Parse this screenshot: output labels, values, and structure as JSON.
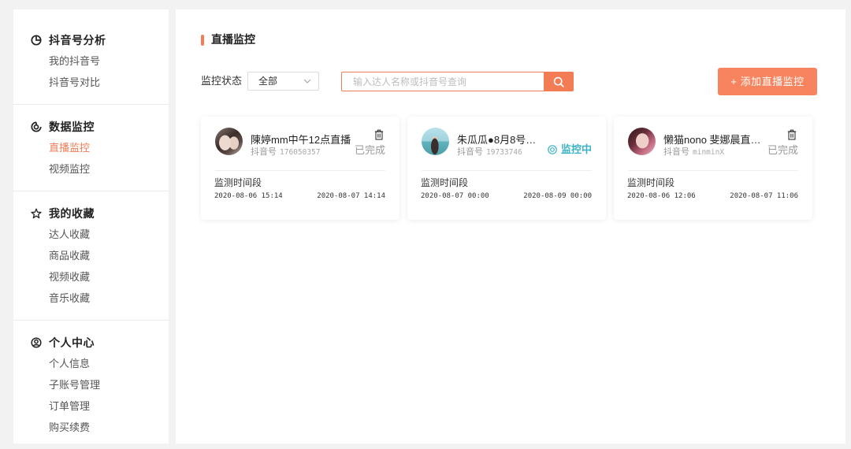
{
  "colors": {
    "accent": "#f47c55",
    "add_button": "#f7845e",
    "monitoring": "#3bb2c4"
  },
  "sidebar": {
    "sections": [
      {
        "title": "抖音号分析",
        "icon": "pie-chart-icon",
        "items": [
          {
            "label": "我的抖音号"
          },
          {
            "label": "抖音号对比"
          }
        ]
      },
      {
        "title": "数据监控",
        "icon": "data-monitor-icon",
        "items": [
          {
            "label": "直播监控",
            "active": true
          },
          {
            "label": "视频监控"
          }
        ]
      },
      {
        "title": "我的收藏",
        "icon": "star-icon",
        "items": [
          {
            "label": "达人收藏"
          },
          {
            "label": "商品收藏"
          },
          {
            "label": "视频收藏"
          },
          {
            "label": "音乐收藏"
          }
        ]
      },
      {
        "title": "个人中心",
        "icon": "user-circle-icon",
        "items": [
          {
            "label": "个人信息"
          },
          {
            "label": "子账号管理"
          },
          {
            "label": "订单管理"
          },
          {
            "label": "购买续费"
          }
        ]
      }
    ]
  },
  "main": {
    "title": "直播监控",
    "filter": {
      "status_label": "监控状态",
      "status_value": "全部",
      "search_placeholder": "输入达人名称或抖音号查询",
      "search_icon": "search-icon",
      "add_button_label": "+ 添加直播监控"
    },
    "cards": [
      {
        "name": "陳婷mm中午12点直播",
        "account_label": "抖音号",
        "account_id": "176050357",
        "action_icon": "trash-icon",
        "status": {
          "text": "已完成"
        },
        "period_label": "监测时间段",
        "start": "2020-08-06 15:14",
        "end": "2020-08-07 14:14"
      },
      {
        "name": "朱瓜瓜●8月8号…",
        "account_label": "抖音号",
        "account_id": "19733746",
        "status": {
          "text": "监控中",
          "icon": "target-icon"
        },
        "period_label": "监测时间段",
        "start": "2020-08-07 00:00",
        "end": "2020-08-09 00:00"
      },
      {
        "name": "懒猫nono 斐娜晨直…",
        "account_label": "抖音号",
        "account_id": "minminX",
        "action_icon": "trash-icon",
        "status": {
          "text": "已完成"
        },
        "period_label": "监测时间段",
        "start": "2020-08-06 12:06",
        "end": "2020-08-07 11:06"
      }
    ]
  }
}
